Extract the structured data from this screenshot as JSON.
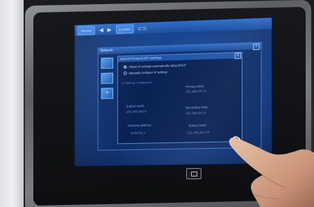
{
  "taskbar": {
    "start_label": "Standard",
    "user_label": "Instelle"
  },
  "window": {
    "title": "Network"
  },
  "dialog": {
    "title": "Internet Protocol (IP) Settings",
    "close_glyph": "X",
    "options": [
      {
        "label": "Obtain IP settings automatically using DHCP",
        "selected": true
      },
      {
        "label": "Manually configure IP settings",
        "selected": false
      }
    ],
    "section_heading": "IP Settings Configuration",
    "fields": {
      "primary_dns_label": "Primary DNS:",
      "primary_dns_value": "131.200.78.74",
      "subnet_mask_label": "Subnet mask:",
      "subnet_mask_value": "255.255.254.0",
      "secondary_dns_label": "Secondary DNS:",
      "secondary_dns_value": "131.200.46.74",
      "gateway_label": "Gateway address:",
      "gateway_value": "10.90.92.1",
      "tertiary_dns_label": "Tertiary DNS:",
      "tertiary_dns_value": "131.200.201.74"
    }
  },
  "icons": [
    "back-arrow-icon",
    "forward-arrow-icon",
    "user-icon",
    "display-icon",
    "network-icon",
    "home-icon"
  ]
}
